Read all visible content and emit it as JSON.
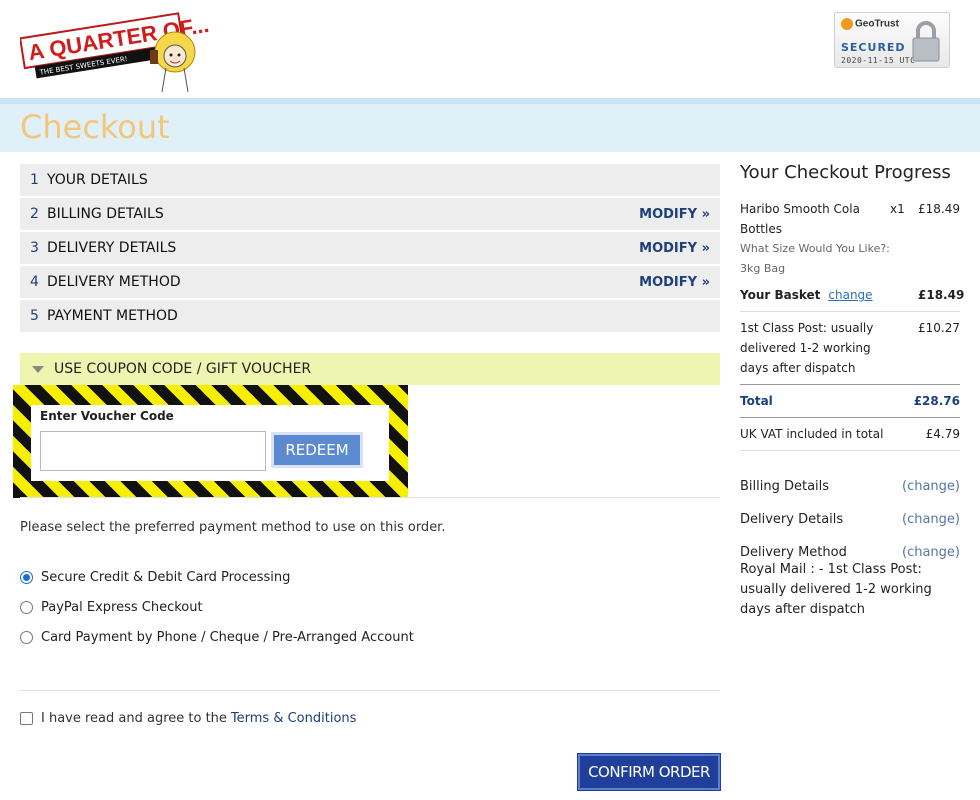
{
  "header": {
    "logo_text": "A QUARTER OF...",
    "logo_tagline": "THE BEST SWEETS EVER!",
    "seal_brand": "GeoTrust",
    "seal_status": "SECURED",
    "seal_date": "2020-11-15 UTC"
  },
  "page_title": "Checkout",
  "steps": [
    {
      "num": "1",
      "label": "YOUR DETAILS",
      "modify": ""
    },
    {
      "num": "2",
      "label": "BILLING DETAILS",
      "modify": "MODIFY »"
    },
    {
      "num": "3",
      "label": "DELIVERY DETAILS",
      "modify": "MODIFY »"
    },
    {
      "num": "4",
      "label": "DELIVERY METHOD",
      "modify": "MODIFY »"
    },
    {
      "num": "5",
      "label": "PAYMENT METHOD",
      "modify": ""
    }
  ],
  "coupon": {
    "heading": "USE COUPON CODE / GIFT VOUCHER",
    "label": "Enter Voucher Code",
    "value": "",
    "placeholder": "",
    "button": "REDEEM"
  },
  "payment": {
    "prompt": "Please select the preferred payment method to use on this order.",
    "methods": [
      {
        "label": "Secure Credit & Debit Card Processing",
        "selected": true
      },
      {
        "label": "PayPal Express Checkout",
        "selected": false
      },
      {
        "label": "Card Payment by Phone / Cheque / Pre-Arranged Account",
        "selected": false
      }
    ]
  },
  "terms": {
    "text": "I have read and agree to the",
    "link": "Terms & Conditions",
    "checked": false
  },
  "confirm_label": "CONFIRM ORDER",
  "sidebar": {
    "title": "Your Checkout Progress",
    "item": {
      "name": "Haribo Smooth Cola Bottles",
      "qty": "x1",
      "price": "£18.49",
      "option": "What Size Would You Like?: 3kg Bag"
    },
    "basket_label": "Your Basket",
    "basket_change": "change",
    "basket_total": "£18.49",
    "shipping_label": "1st Class Post: usually delivered 1-2 working days after dispatch",
    "shipping_price": "£10.27",
    "total_label": "Total",
    "total_value": "£28.76",
    "vat_label": "UK VAT included in total",
    "vat_value": "£4.79",
    "billing_label": "Billing Details",
    "delivery_label": "Delivery Details",
    "method_label": "Delivery Method",
    "change_label": "(change)",
    "method_value": "Royal Mail : - 1st Class Post: usually delivered 1-2 working days after dispatch"
  },
  "colors": {
    "accent_navy": "#1f3f9a",
    "title_orange": "#f3c67c",
    "banner_blue": "#dff0f8",
    "coupon_yellow": "#eef5b0",
    "hazard_yellow": "#f7ef00"
  }
}
